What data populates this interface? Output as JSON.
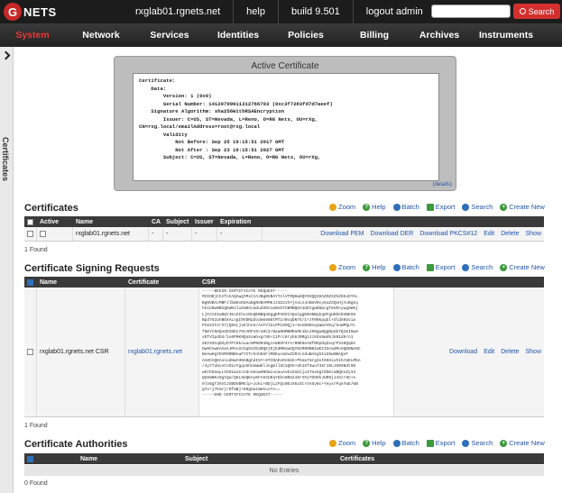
{
  "header": {
    "logo_g": "G",
    "logo_text": "NETS",
    "host": "rxglab01.rgnets.net",
    "help": "help",
    "build": "build 9.501",
    "logout": "logout admin",
    "search_placeholder": "",
    "search_button": "Search"
  },
  "menu": [
    "System",
    "Network",
    "Services",
    "Identities",
    "Policies",
    "Billing",
    "Archives",
    "Instruments"
  ],
  "sidebar": {
    "label": "Certificates"
  },
  "active_certificate": {
    "title": "Active Certificate",
    "text": "Certificate:\n    Data:\n        Version: 1 (0x0)\n        Serial Number: 14120799611312766703 (0xc3f7283fd7d7aeef)\n    Signature Algorithm: sha256WithRSAEncryption\n        Issuer: C=US, ST=Nevada, L=Reno, O=RG Nets, OU=rXg,\nCN=rxg.local/emailAddress=root@rxg.local\n        Validity\n            Not Before: Sep 25 19:15:51 2017 GMT\n            Not After : Sep 23 19:15:51 2027 GMT\n        Subject: C=US, ST=Nevada, L=Reno, O=RG Nets, OU=rXg,",
    "details_link": "(details)"
  },
  "toolbar": {
    "zoom": "Zoom",
    "help": "Help",
    "batch": "Batch",
    "export": "Export",
    "search": "Search",
    "create": "Create New"
  },
  "certificates": {
    "title": "Certificates",
    "columns": [
      "Active",
      "Name",
      "CA",
      "Subject",
      "Issuer",
      "Expiration"
    ],
    "row": {
      "name": "rxglab01.rgnets.net",
      "ca": "-",
      "subject": "-",
      "issuer": "-",
      "expiration": "-",
      "actions": [
        "Download PEM",
        "Download DER",
        "Download PKCS#12",
        "Edit",
        "Delete",
        "Show"
      ]
    },
    "found": "1 Found"
  },
  "csr": {
    "title": "Certificate Signing Requests",
    "columns": [
      "Name",
      "Certificate",
      "CSR"
    ],
    "row": {
      "name": "rxglab01.rgnets.net CSR",
      "certificate": "rxglab01.rgnets.net",
      "text": "-----BEGIN CERTIFICATE REQUEST-----\nMIIDBjCCAfoCAQAwgYMxCzAJBgNVBAYTAlVTMQ8wDQYDVQQIDAZOZXZhZGExDTAL\nBgNVBAcMBFJlbm8xEDAaBgNVBAMMEJJ4Z2xhYjAxLnJnbmV0cy5uZXQxHjAcBgkq\nhkiG9w0BCQEWD2luZm9AcmduZXRzLmNvbTCBMBQGA1UECgwNUmcgTmV0cywgSW5j\nLjCCASIwDQYJKoZIhvcNAQEBBQADggEPADCCAQoCggEBANBqkq8FgUKbCD4NKS8\nBpd761UnBOXALogI9VDRpZodem8mOtMTinRoqbN75/I+zFRNkpqGl+OldXKUvia\nPtmXIhtrX7jQ9XLjvGlhvG/AvFVlGLPPi0OQj1+5onDN9nq1WwYVGq/SoWPQuTc\nf8mYtNOQsODIOEv75tARFVSra0C3/NaaNNMNMRaRk1bnJ9Ogw8QgRpGb7Q1KIOw9\nvETVIpdO4/1o6P0K9QnXsWnxgr85+11P/c8ryb8JMRg1Jzk5n8wU5JkN1d9/n1\nZKz93CqDGyD7Pt9kouacNPNOR4NgJsmNVP4Y4+RNK0AA8fBOpOqZoqrP31KQqOA\nDwHCAwEAAaAJMAcGCSqGSIb3DQEJDjEdMBswGQYDVR0RBBIwEIIOcmdMoVQEBNANC\nBeAwHgYDVR0RBBcwFYITchnhbGFlMDEucmduZXRzLnduBAkghkiG9w0BAQsF\nAAOCAQEAsnodHwtHNABghdI5Y+8TCNAEvDnbGG+P5Ua7mrg3ot69Xivh1hrmELMbn\n/4ytTubvvCsO1oYgqoGhUuWwElJvgWllSC1Q0X+Uh1Sf4wu74Sr19LJO0SNdt5N\nw6rEbGwyLIb91w1IcC8cHenwHNOmivnauAvEvZabijuITaxHgYZbKzaBQGnZyId\nQG6mNKx0gtQw/QHL9aQKAyKFA92UDqYEbo8B5248rXFp7O89kJUR9j14Xzr8C+e\n9ln8gT3AVIJXBDVBMGlp+JokL+BDjL2FQx9EoX6xXtrVASyNc+YeyxrPqe7wE/WN\ngYv+j7Emrjr0fwBj+69g5a18WsLnYA==\n-----END CERTIFICATE REQUEST-----",
      "actions": [
        "Download",
        "Edit",
        "Delete",
        "Show"
      ]
    },
    "found": "1 Found"
  },
  "ca": {
    "title": "Certificate Authorities",
    "columns": [
      "Name",
      "Subject",
      "Certificates"
    ],
    "empty": "No Entries",
    "found": "0 Found"
  }
}
